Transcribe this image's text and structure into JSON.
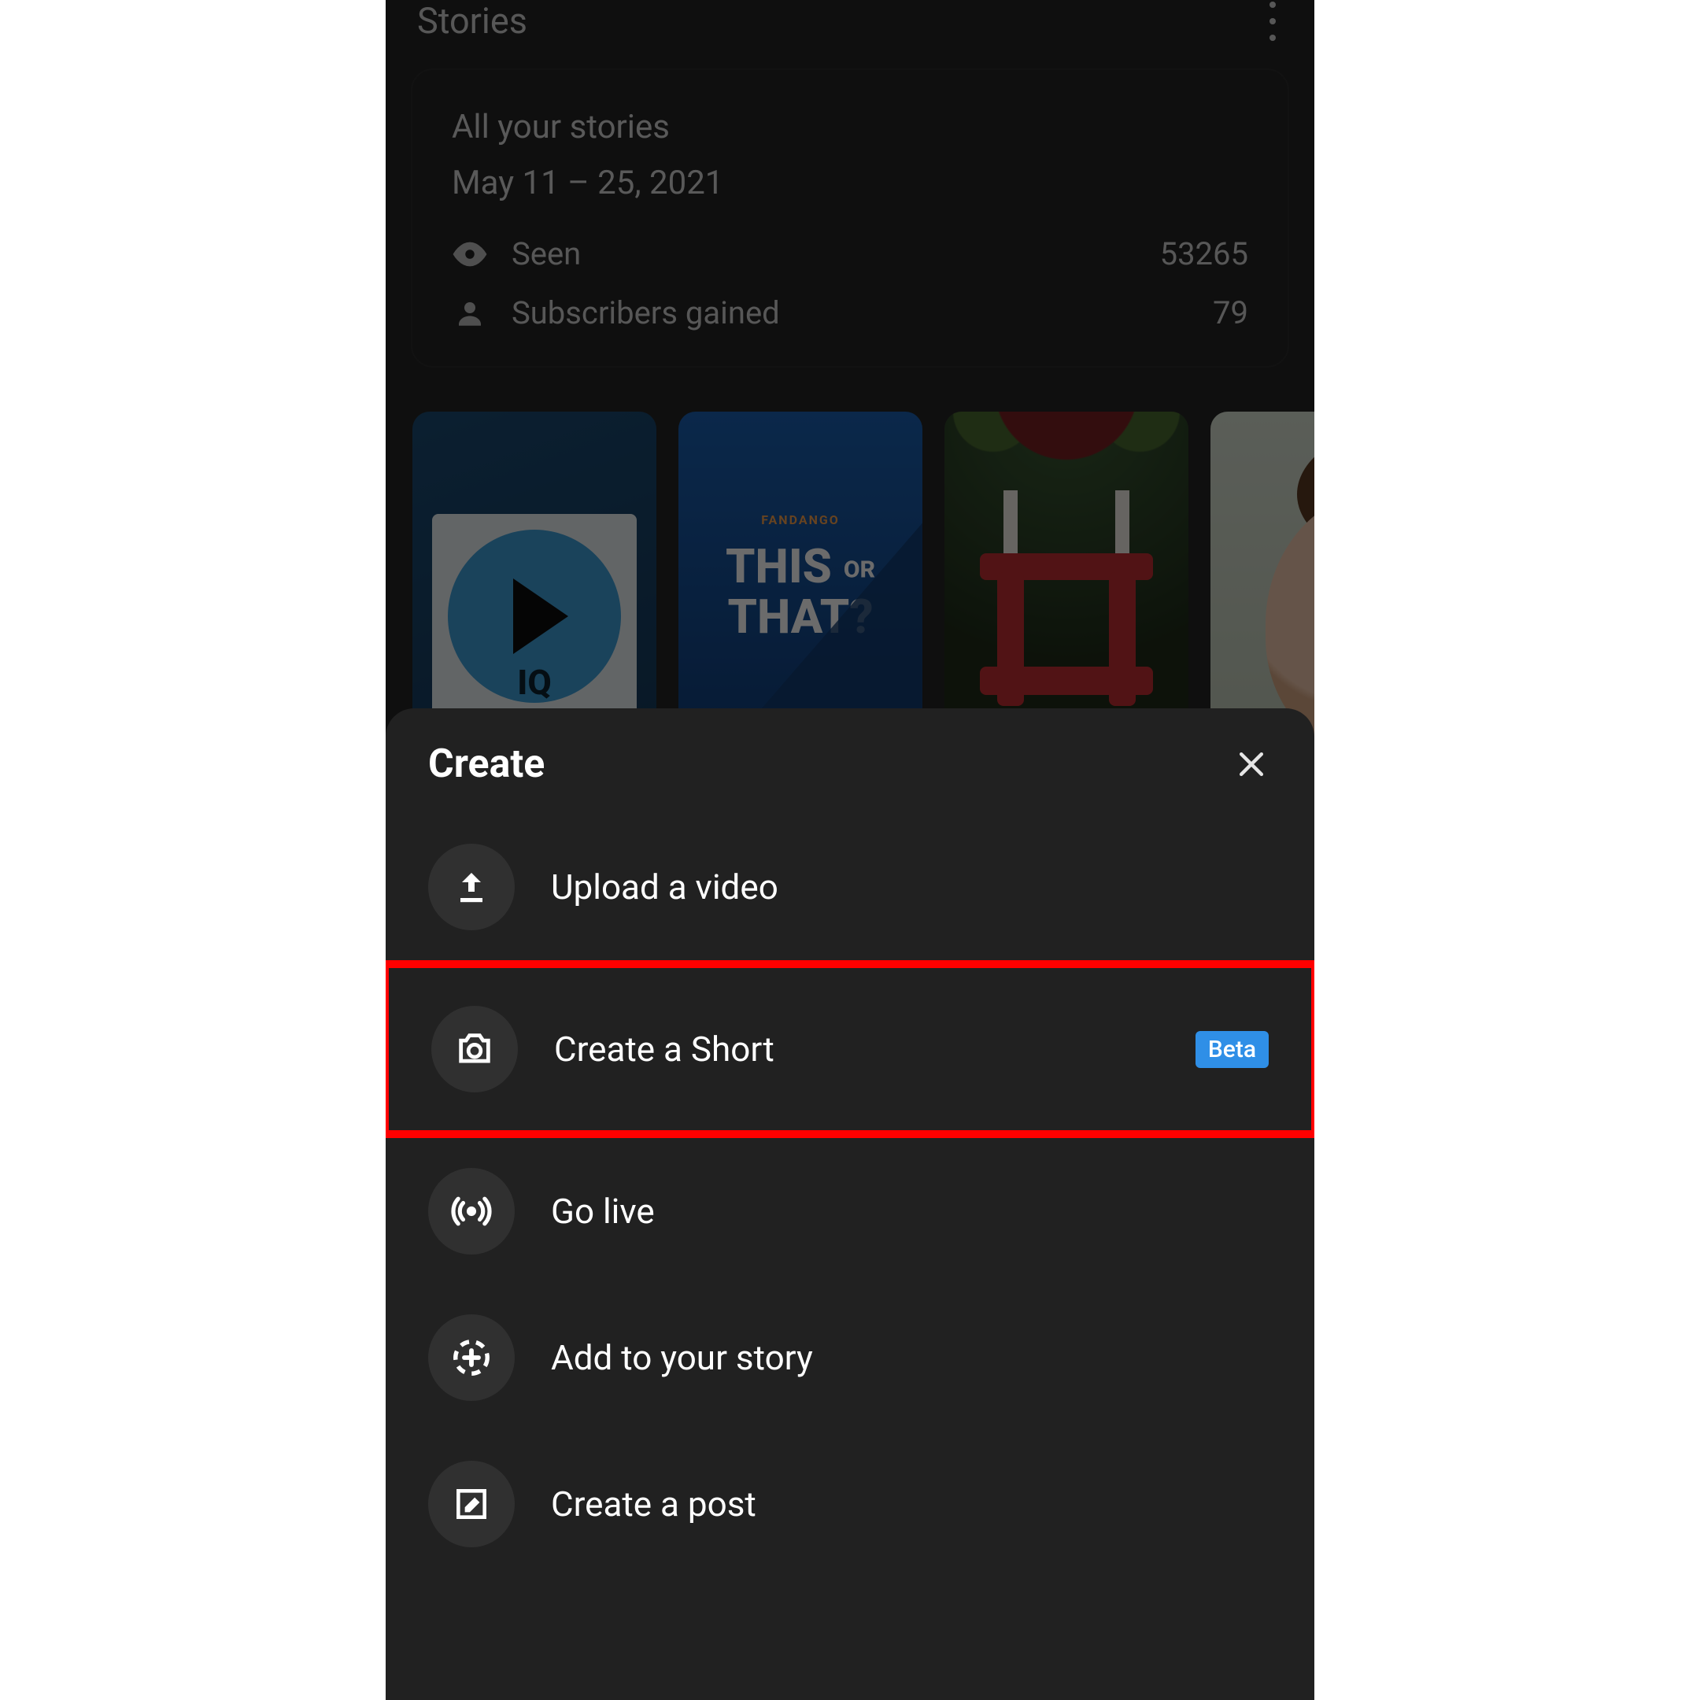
{
  "header": {
    "title": "Stories"
  },
  "stories_card": {
    "title": "All your stories",
    "date_range": "May 11 – 25, 2021",
    "seen_label": "Seen",
    "seen_value": "53265",
    "subs_label": "Subscribers gained",
    "subs_value": "79"
  },
  "thumbs": {
    "t1_label": "IQ",
    "t2_brand": "FANDANGO",
    "t2_line1": "THIS",
    "t2_or": "OR",
    "t2_line2": "THAT?"
  },
  "sheet": {
    "title": "Create",
    "items": [
      {
        "icon": "upload",
        "label": "Upload a video"
      },
      {
        "icon": "camera",
        "label": "Create a Short",
        "badge": "Beta",
        "highlighted": true
      },
      {
        "icon": "live",
        "label": "Go live"
      },
      {
        "icon": "addstory",
        "label": "Add to your story"
      },
      {
        "icon": "post",
        "label": "Create a post"
      }
    ]
  },
  "colors": {
    "highlight": "#ff0000",
    "badge": "#2f8fe7"
  }
}
